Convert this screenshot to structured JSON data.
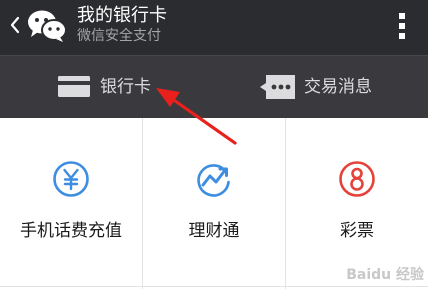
{
  "header": {
    "title": "我的银行卡",
    "subtitle": "微信安全支付",
    "back_icon": "chevron-left-icon",
    "app_icon": "wechat-icon",
    "more_icon": "more-vertical-icon"
  },
  "tabs": [
    {
      "label": "银行卡",
      "icon": "bank-card-icon"
    },
    {
      "label": "交易消息",
      "icon": "message-icon"
    }
  ],
  "services": [
    {
      "label": "手机话费充值",
      "icon": "yuan-icon"
    },
    {
      "label": "理财通",
      "icon": "trend-icon"
    },
    {
      "label": "彩票",
      "icon": "lottery-icon"
    }
  ],
  "colors": {
    "header_bg": "#2b2c30",
    "tab_bg": "#3a3a3e",
    "icon_blue": "#3d8ee0",
    "icon_red": "#e4423a",
    "annotation_red": "#e8211c"
  },
  "watermark": "Baidu 经验"
}
